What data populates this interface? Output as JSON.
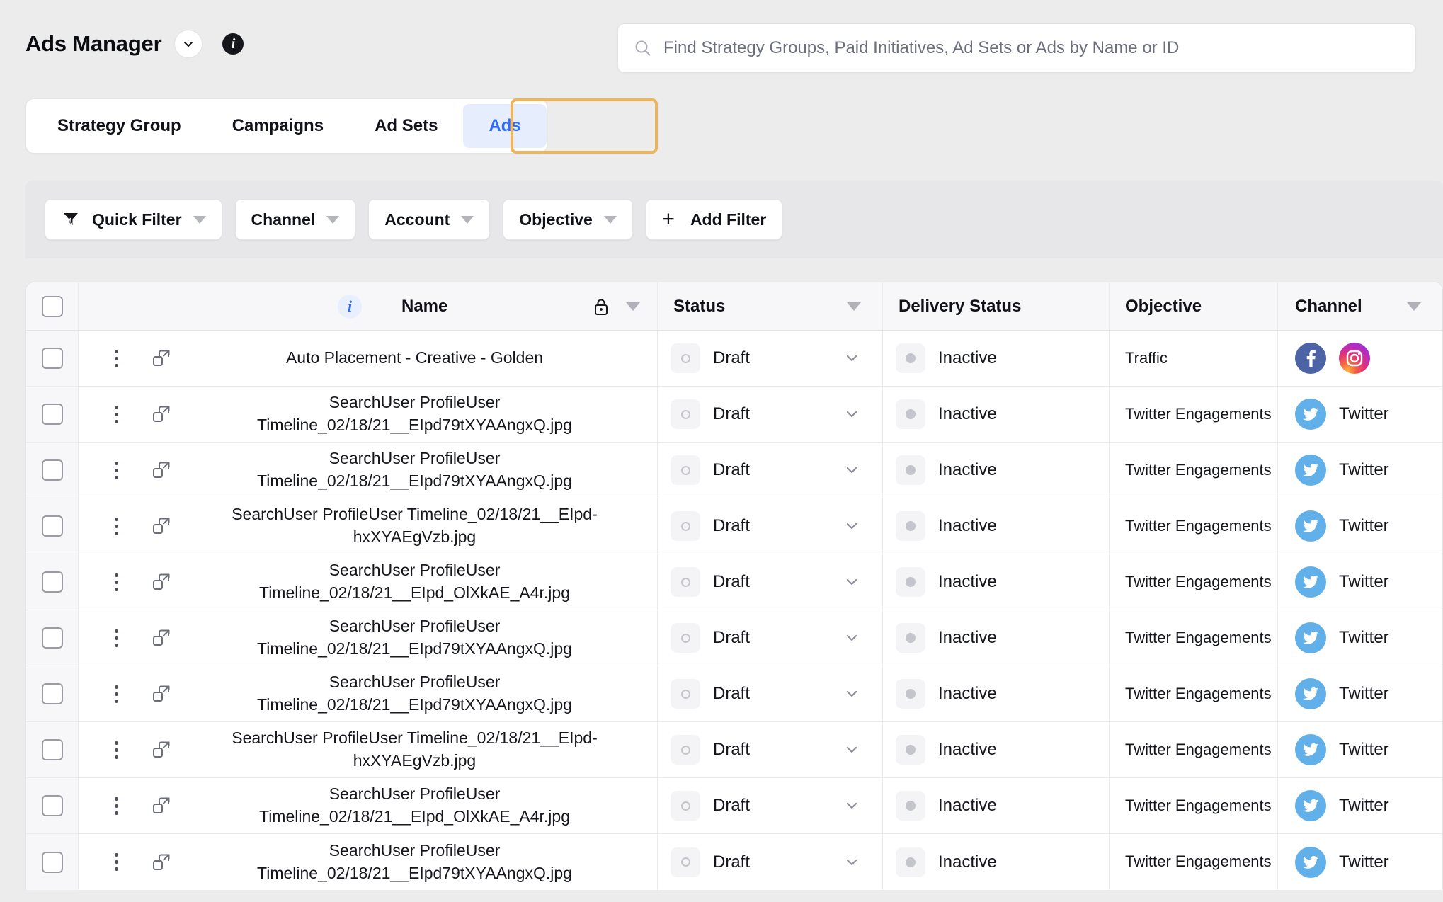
{
  "header": {
    "title": "Ads Manager",
    "chevron_icon": "chevron-down-icon",
    "info_icon": "info-icon"
  },
  "search": {
    "icon": "search-icon",
    "placeholder": "Find Strategy Groups, Paid Initiatives, Ad Sets or Ads by Name or ID",
    "value": ""
  },
  "tabs": [
    {
      "label": "Strategy Group",
      "active": false
    },
    {
      "label": "Campaigns",
      "active": false
    },
    {
      "label": "Ad Sets",
      "active": false
    },
    {
      "label": "Ads",
      "active": true
    }
  ],
  "filters": [
    {
      "label": "Quick Filter",
      "icon": "filter-lightning-icon",
      "caret": true
    },
    {
      "label": "Channel",
      "icon": null,
      "caret": true
    },
    {
      "label": "Account",
      "icon": null,
      "caret": true
    },
    {
      "label": "Objective",
      "icon": null,
      "caret": true
    },
    {
      "label": "Add Filter",
      "icon": "plus-icon",
      "caret": false
    }
  ],
  "table": {
    "columns": [
      {
        "key": "check",
        "label": ""
      },
      {
        "key": "name",
        "label": "Name",
        "info_icon": "info-icon",
        "lock_icon": "lock-icon",
        "caret": true
      },
      {
        "key": "status",
        "label": "Status",
        "caret": true
      },
      {
        "key": "delivery",
        "label": "Delivery Status",
        "caret": false
      },
      {
        "key": "objective",
        "label": "Objective",
        "caret": false
      },
      {
        "key": "channel",
        "label": "Channel",
        "caret": true
      }
    ],
    "rows": [
      {
        "name": "Auto Placement - Creative - Golden",
        "status": "Draft",
        "delivery": "Inactive",
        "objective": "Traffic",
        "channels": [
          {
            "name": "facebook",
            "label": ""
          },
          {
            "name": "instagram",
            "label": ""
          }
        ]
      },
      {
        "name": "SearchUser ProfileUser Timeline_02/18/21__EIpd79tXYAAngxQ.jpg",
        "status": "Draft",
        "delivery": "Inactive",
        "objective": "Twitter Engagements",
        "channels": [
          {
            "name": "twitter",
            "label": "Twitter"
          }
        ]
      },
      {
        "name": "SearchUser ProfileUser Timeline_02/18/21__EIpd79tXYAAngxQ.jpg",
        "status": "Draft",
        "delivery": "Inactive",
        "objective": "Twitter Engagements",
        "channels": [
          {
            "name": "twitter",
            "label": "Twitter"
          }
        ]
      },
      {
        "name": "SearchUser ProfileUser Timeline_02/18/21__EIpd-hxXYAEgVzb.jpg",
        "status": "Draft",
        "delivery": "Inactive",
        "objective": "Twitter Engagements",
        "channels": [
          {
            "name": "twitter",
            "label": "Twitter"
          }
        ]
      },
      {
        "name": "SearchUser ProfileUser Timeline_02/18/21__EIpd_OlXkAE_A4r.jpg",
        "status": "Draft",
        "delivery": "Inactive",
        "objective": "Twitter Engagements",
        "channels": [
          {
            "name": "twitter",
            "label": "Twitter"
          }
        ]
      },
      {
        "name": "SearchUser ProfileUser Timeline_02/18/21__EIpd79tXYAAngxQ.jpg",
        "status": "Draft",
        "delivery": "Inactive",
        "objective": "Twitter Engagements",
        "channels": [
          {
            "name": "twitter",
            "label": "Twitter"
          }
        ]
      },
      {
        "name": "SearchUser ProfileUser Timeline_02/18/21__EIpd79tXYAAngxQ.jpg",
        "status": "Draft",
        "delivery": "Inactive",
        "objective": "Twitter Engagements",
        "channels": [
          {
            "name": "twitter",
            "label": "Twitter"
          }
        ]
      },
      {
        "name": "SearchUser ProfileUser Timeline_02/18/21__EIpd-hxXYAEgVzb.jpg",
        "status": "Draft",
        "delivery": "Inactive",
        "objective": "Twitter Engagements",
        "channels": [
          {
            "name": "twitter",
            "label": "Twitter"
          }
        ]
      },
      {
        "name": "SearchUser ProfileUser Timeline_02/18/21__EIpd_OlXkAE_A4r.jpg",
        "status": "Draft",
        "delivery": "Inactive",
        "objective": "Twitter Engagements",
        "channels": [
          {
            "name": "twitter",
            "label": "Twitter"
          }
        ]
      },
      {
        "name": "SearchUser ProfileUser Timeline_02/18/21__EIpd79tXYAAngxQ.jpg",
        "status": "Draft",
        "delivery": "Inactive",
        "objective": "Twitter Engagements",
        "channels": [
          {
            "name": "twitter",
            "label": "Twitter"
          }
        ]
      }
    ],
    "row_menu_icon": "kebab-menu-icon",
    "row_open_icon": "open-in-new-icon"
  },
  "colors": {
    "accent_blue": "#2f6bff",
    "focus_ring": "#f0b45a",
    "tab_active_bg": "#e6eefe",
    "page_bg": "#ececed",
    "facebook": "#4c63a5",
    "twitter": "#62b0ea"
  }
}
